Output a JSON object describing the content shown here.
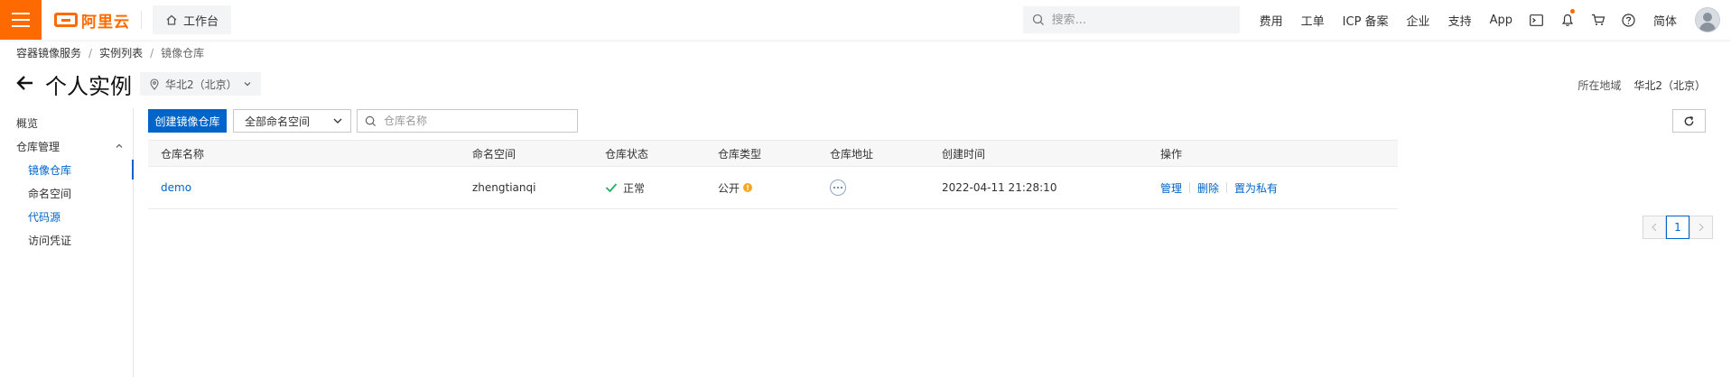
{
  "topbar": {
    "logo_text": "阿里云",
    "workbench_label": "工作台",
    "search_placeholder": "搜索...",
    "links": [
      "费用",
      "工单",
      "ICP 备案",
      "企业",
      "支持",
      "App"
    ],
    "lang_label": "简体",
    "accent_color": "#ff6a00"
  },
  "breadcrumb": [
    "容器镜像服务",
    "实例列表",
    "镜像仓库"
  ],
  "header": {
    "title": "个人实例",
    "region_select": "华北2（北京）",
    "region_info_label": "所在地域",
    "region_info_value": "华北2（北京）"
  },
  "sidebar": {
    "overview": "概览",
    "repo_manage": "仓库管理",
    "items": [
      "镜像仓库",
      "命名空间",
      "代码源",
      "访问凭证"
    ]
  },
  "toolbar": {
    "create_button": "创建镜像仓库",
    "namespace_select": "全部命名空间",
    "search_placeholder": "仓库名称"
  },
  "table": {
    "headers": [
      "仓库名称",
      "命名空间",
      "仓库状态",
      "仓库类型",
      "仓库地址",
      "创建时间",
      "操作"
    ],
    "rows": [
      {
        "name": "demo",
        "namespace": "zhengtianqi",
        "status": "正常",
        "type": "公开",
        "created": "2022-04-11 21:28:10",
        "ops": [
          "管理",
          "删除",
          "置为私有"
        ]
      }
    ]
  },
  "pagination": {
    "current_page": "1"
  },
  "colors": {
    "primary": "#0064c8",
    "success": "#23b066",
    "warning": "#f5a623"
  }
}
